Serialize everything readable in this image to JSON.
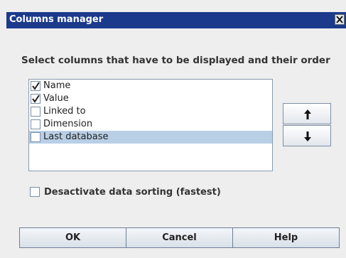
{
  "window": {
    "title": "Columns manager"
  },
  "instruction": "Select columns that have to be displayed and their order",
  "columns": [
    {
      "label": "Name",
      "checked": true,
      "selected": false
    },
    {
      "label": "Value",
      "checked": true,
      "selected": false
    },
    {
      "label": "Linked to",
      "checked": false,
      "selected": false
    },
    {
      "label": "Dimension",
      "checked": false,
      "selected": false
    },
    {
      "label": "Last database",
      "checked": false,
      "selected": true
    }
  ],
  "move_buttons": {
    "up_icon": "arrow-up-icon",
    "down_icon": "arrow-down-icon"
  },
  "sort_option": {
    "label": "Desactivate data sorting (fastest)",
    "checked": false
  },
  "buttons": {
    "ok": "OK",
    "cancel": "Cancel",
    "help": "Help"
  },
  "colors": {
    "titlebar": "#1b3a8c",
    "selection": "#b8cfe5",
    "background": "#eeeeee"
  }
}
